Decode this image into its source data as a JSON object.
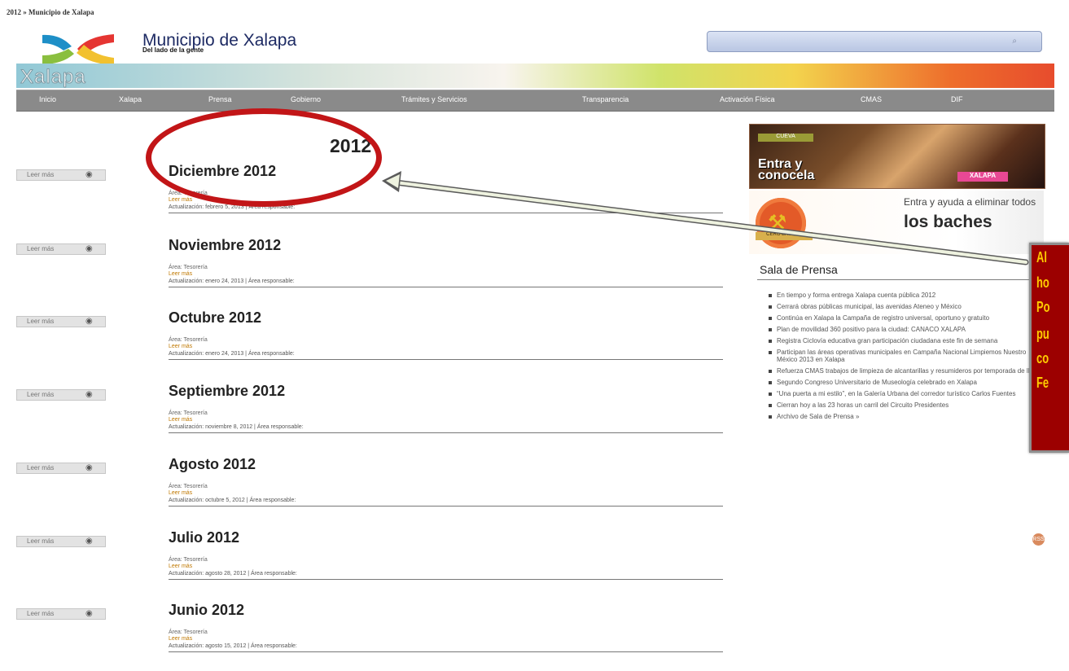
{
  "browser": {
    "title": "2012 » Municipio de Xalapa"
  },
  "header": {
    "site_title": "Municipio de Xalapa",
    "tagline": "Del lado de la gente",
    "banner_label": "Xalapa",
    "search_placeholder": ""
  },
  "nav": {
    "items": [
      "Inicio",
      "Xalapa",
      "Prensa",
      "Gobierno",
      "Trámites y Servicios",
      "Transparencia",
      "Activación Física",
      "CMAS",
      "DIF"
    ]
  },
  "main": {
    "heading": "2012",
    "read_more_label": "Leer más",
    "entries": [
      {
        "title": "Diciembre 2012",
        "area": "Área: Tesorería",
        "link": "Leer más",
        "update": "Actualización: febrero 5, 2013 | Área responsable:"
      },
      {
        "title": "Noviembre 2012",
        "area": "Área: Tesorería",
        "link": "Leer más",
        "update": "Actualización: enero 24, 2013 | Área responsable:"
      },
      {
        "title": "Octubre 2012",
        "area": "Área: Tesorería",
        "link": "Leer más",
        "update": "Actualización: enero 24, 2013 | Área responsable:"
      },
      {
        "title": "Septiembre 2012",
        "area": "Área: Tesorería",
        "link": "Leer más",
        "update": "Actualización: noviembre 8, 2012 | Área responsable:"
      },
      {
        "title": "Agosto 2012",
        "area": "Área: Tesorería",
        "link": "Leer más",
        "update": "Actualización: octubre 5, 2012 | Área responsable:"
      },
      {
        "title": "Julio 2012",
        "area": "Área: Tesorería",
        "link": "Leer más",
        "update": "Actualización: agosto 28, 2012 | Área responsable:"
      },
      {
        "title": "Junio 2012",
        "area": "Área: Tesorería",
        "link": "Leer más",
        "update": "Actualización: agosto 15, 2012 | Área responsable:"
      }
    ]
  },
  "sidebar": {
    "ad1": {
      "top": "CUEVA",
      "text": "Entra y conocela",
      "badge": "XALAPA"
    },
    "ad2": {
      "line_a": "Entra y ayuda a eliminar todos",
      "line_b": "los baches",
      "strip": "CERO BACHES"
    },
    "title": "Sala de Prensa",
    "news": [
      "En tiempo y forma entrega Xalapa cuenta pública 2012",
      "Cerrará obras públicas municipal, las avenidas Ateneo y México",
      "Continúa en Xalapa la Campaña de registro universal, oportuno y gratuito",
      "Plan de movilidad 360 positivo para la ciudad: CANACO XALAPA",
      "Registra Ciclovía educativa gran participación ciudadana este fin de semana",
      "Participan las áreas operativas municipales en Campaña Nacional Limpiemos Nuestro México 2013 en Xalapa",
      "Refuerza CMAS trabajos de limpieza de alcantarillas y resumideros por temporada de lluvias",
      "Segundo Congreso Universitario de Museología celebrado en Xalapa",
      "“Una puerta a mi estilo”, en la Galería Urbana del corredor turístico Carlos Fuentes",
      "Cierran hoy a las 23 horas un carril del Circuito Presidentes",
      "Archivo de Sala de Prensa »"
    ],
    "rss": "RSS"
  },
  "annotation": {
    "callout_lines": [
      "Al",
      "ho",
      "Po",
      "pu",
      "co",
      "Fe"
    ]
  },
  "colors": {
    "nav_bg": "#8a8a8a",
    "accent_red": "#c21517",
    "callout_bg": "#9c0000",
    "callout_text": "#ffcc00"
  }
}
